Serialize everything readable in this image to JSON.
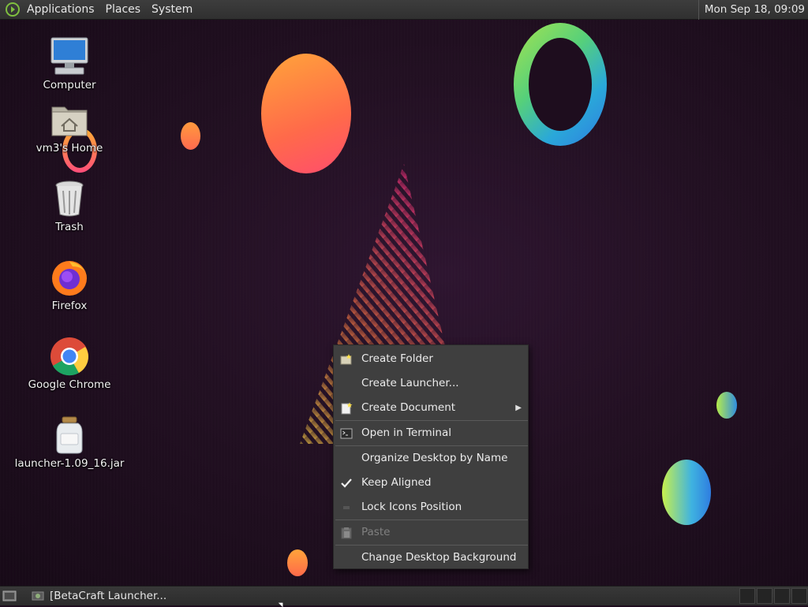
{
  "top_panel": {
    "menus": [
      {
        "label": "Applications"
      },
      {
        "label": "Places"
      },
      {
        "label": "System"
      }
    ],
    "clock": "Mon Sep 18, 09:09"
  },
  "desktop_icons": [
    {
      "label": "Computer",
      "icon": "computer-icon"
    },
    {
      "label": "vm3's Home",
      "icon": "home-folder-icon"
    },
    {
      "label": "Trash",
      "icon": "trash-icon"
    },
    {
      "label": "Firefox",
      "icon": "firefox-icon"
    },
    {
      "label": "Google Chrome",
      "icon": "chrome-icon"
    },
    {
      "label": "launcher-1.09_16.jar",
      "icon": "jar-file-icon"
    }
  ],
  "context_menu": {
    "items": [
      {
        "label": "Create Folder",
        "icon": "new-folder-icon",
        "enabled": true
      },
      {
        "label": "Create Launcher...",
        "enabled": true
      },
      {
        "label": "Create Document",
        "icon": "new-document-icon",
        "enabled": true,
        "submenu": true
      },
      {
        "label": "Open in Terminal",
        "icon": "terminal-icon",
        "enabled": true
      },
      {
        "label": "Organize Desktop by Name",
        "enabled": true
      },
      {
        "label": "Keep Aligned",
        "checked": true,
        "enabled": true
      },
      {
        "label": "Lock Icons Position",
        "checked": false,
        "enabled": true
      },
      {
        "label": "Paste",
        "icon": "paste-icon",
        "enabled": false
      },
      {
        "label": "Change Desktop Background",
        "enabled": true
      }
    ]
  },
  "bottom_panel": {
    "task_label": "[BetaCraft Launcher..."
  },
  "colors": {
    "panel": "#333333",
    "menu_bg": "#3f3f3f",
    "desktop_bg": "#1e0d1e"
  }
}
